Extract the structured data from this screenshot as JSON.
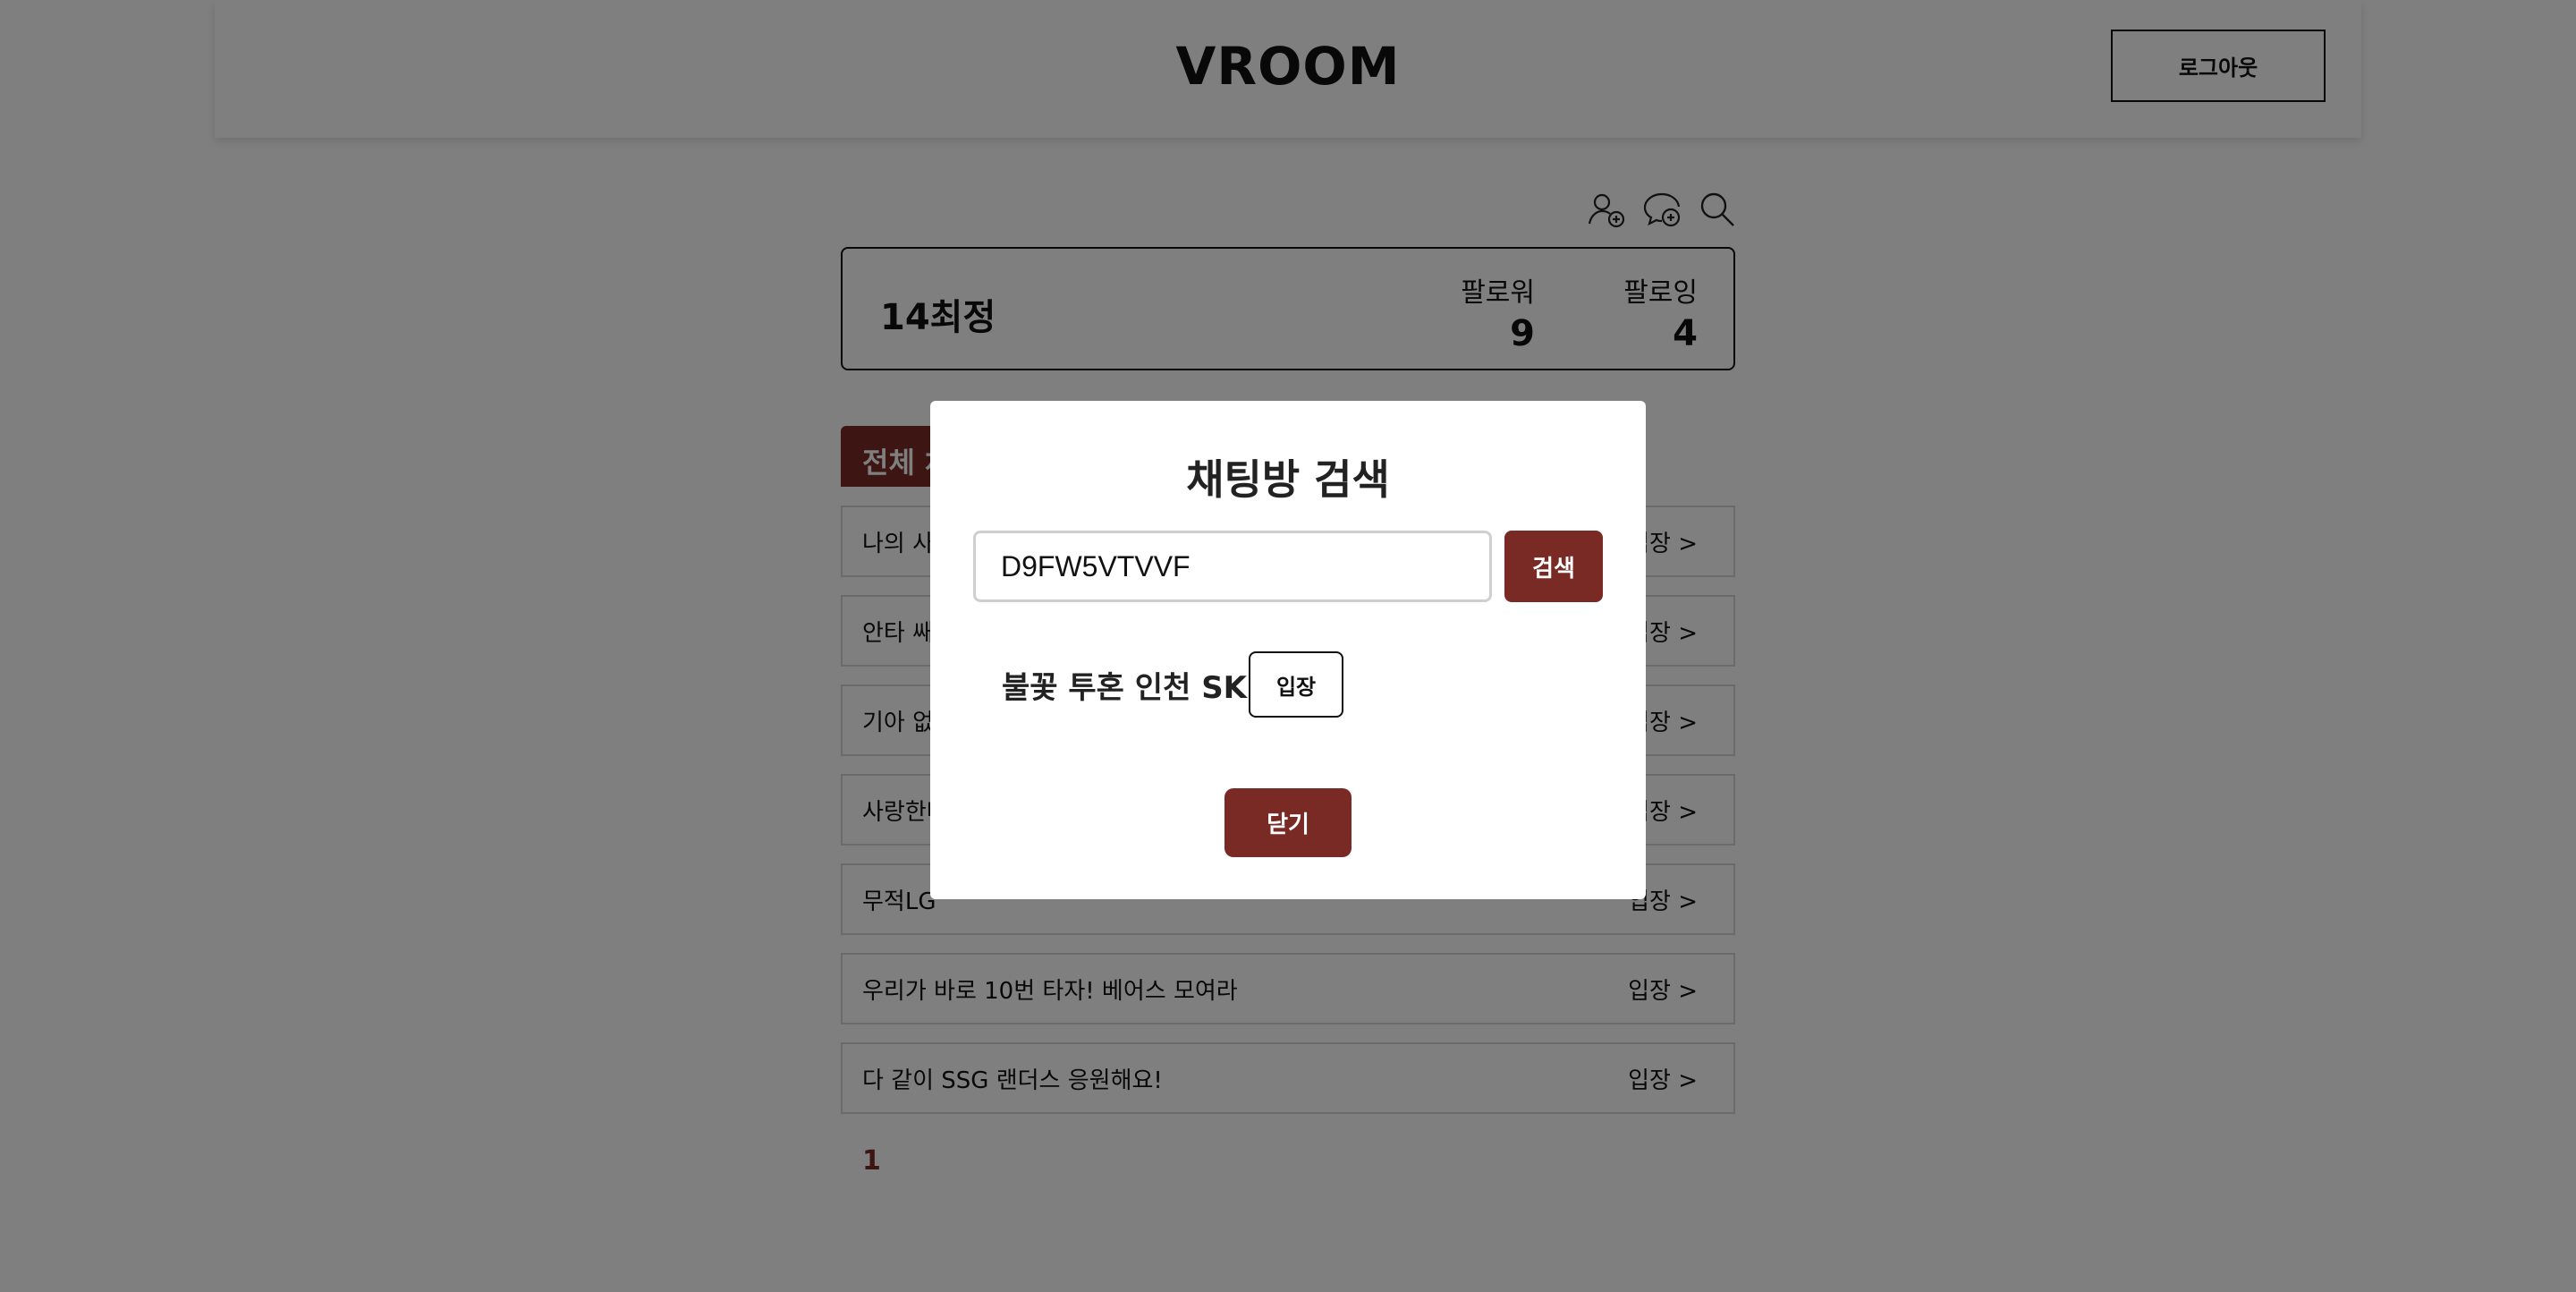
{
  "header": {
    "brand": "VROOM",
    "logout_label": "로그아웃"
  },
  "toolbar": {
    "icons": [
      "add-user-icon",
      "add-chat-icon",
      "search-icon"
    ]
  },
  "profile": {
    "name": "14최정",
    "followers_label": "팔로워",
    "followers_count": "9",
    "following_label": "팔로잉",
    "following_count": "4"
  },
  "tabs": {
    "all_label": "전체 채"
  },
  "rooms": [
    {
      "title": "나의 사",
      "enter": "입장 >"
    },
    {
      "title": "안타 쌔",
      "enter": "입장 >"
    },
    {
      "title": "기아 없",
      "enter": "입장 >"
    },
    {
      "title": "사랑한다",
      "enter": "입장 >"
    },
    {
      "title": "무적LG",
      "enter": "입장 >"
    },
    {
      "title": "우리가 바로 10번 타자! 베어스 모여라",
      "enter": "입장 >"
    },
    {
      "title": "다 같이 SSG 랜더스 응원해요!",
      "enter": "입장 >"
    }
  ],
  "pagination": {
    "current": "1"
  },
  "modal": {
    "title": "채팅방 검색",
    "search_value": "D9FW5VTVVF",
    "search_button": "검색",
    "result_name": "불꽃 투혼 인천 SK",
    "result_enter": "입장",
    "close_button": "닫기"
  },
  "colors": {
    "accent": "#7a2a24",
    "overlay": "rgba(0,0,0,0.5)"
  }
}
